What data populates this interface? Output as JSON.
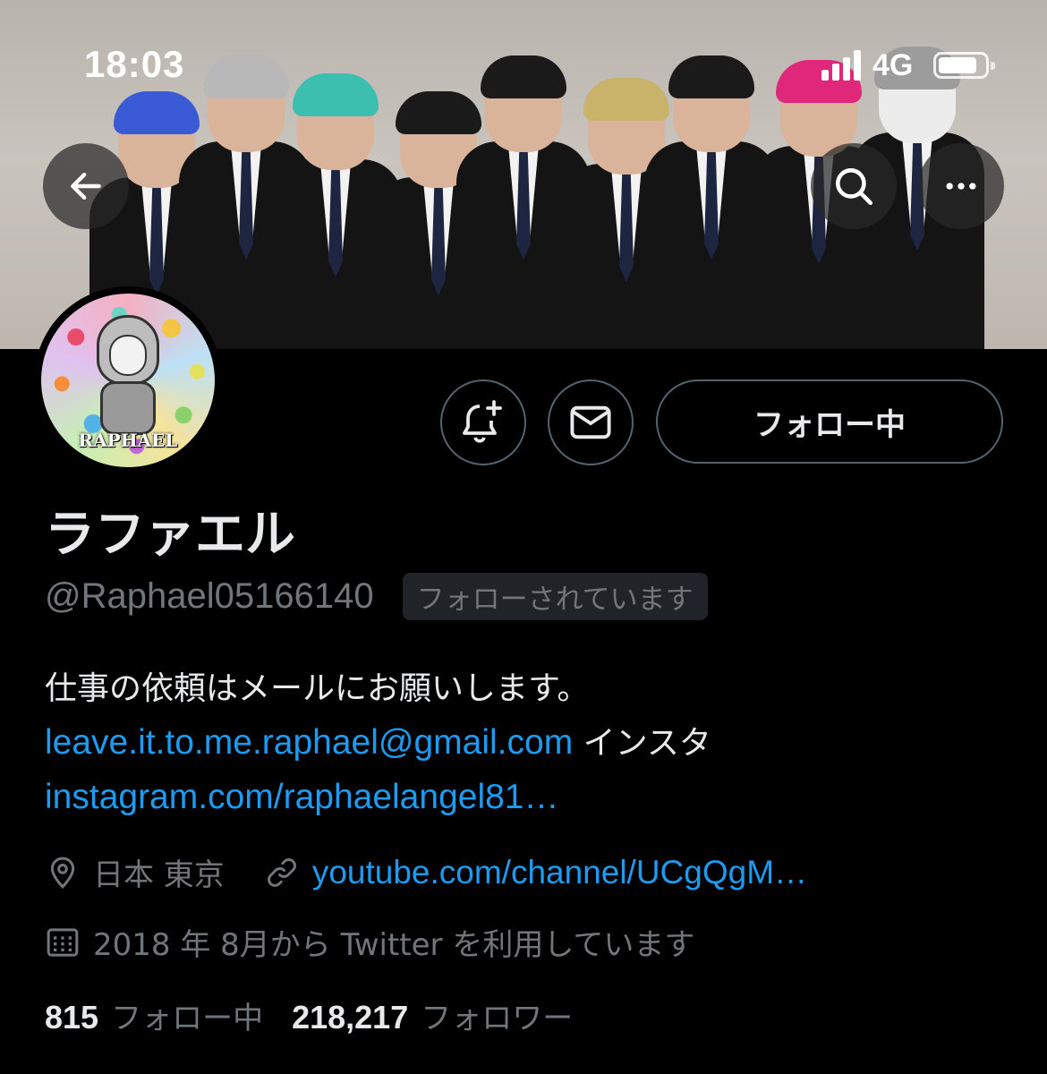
{
  "status_bar": {
    "time": "18:03",
    "network": "4G",
    "battery_level": 0.75
  },
  "header": {
    "back_icon": "arrow-left-icon",
    "search_icon": "search-icon",
    "more_icon": "more-horizontal-icon"
  },
  "avatar": {
    "logo_text": "RAPHAEL"
  },
  "actions": {
    "notify_icon": "bell-plus-icon",
    "message_icon": "envelope-icon",
    "follow_label": "フォロー中"
  },
  "profile": {
    "display_name": "ラファエル",
    "handle": "@Raphael05166140",
    "follows_you_badge": "フォローされています",
    "bio_line1": "仕事の依頼はメールにお願いします。",
    "bio_email": "leave.it.to.me.raphael@gmail.com",
    "bio_insta_label": " インスタ",
    "bio_insta_link": "instagram.com/raphaelangel81…",
    "location": "日本 東京",
    "website": "youtube.com/channel/UCgQgM…",
    "joined": "2018 年 8月から Twitter を利用しています"
  },
  "stats": {
    "following_count": "815",
    "following_label": "フォロー中",
    "followers_count": "218,217",
    "followers_label": "フォロワー"
  },
  "colors": {
    "background": "#000000",
    "primary_text": "#e7e9ea",
    "secondary_text": "#71767b",
    "link": "#1d9bf0",
    "border": "#536471"
  }
}
